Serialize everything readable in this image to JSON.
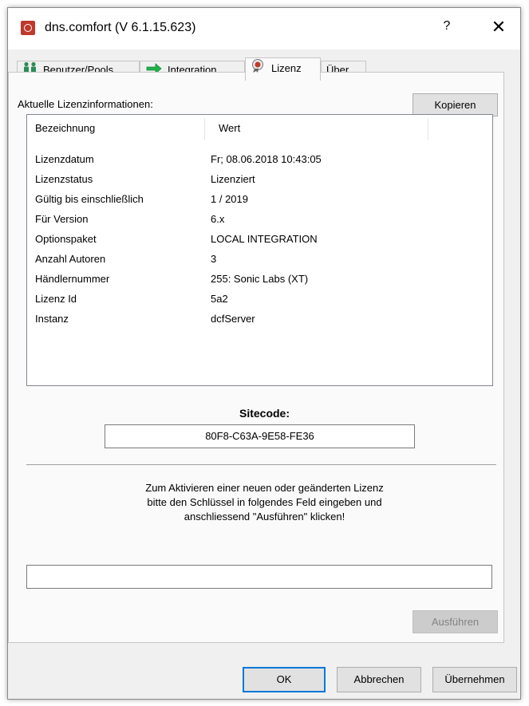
{
  "window": {
    "title": "dns.comfort (V 6.1.15.623)",
    "help": "?",
    "close": "✕"
  },
  "tabs": [
    {
      "label": "Benutzer/Pools",
      "icon": "users-icon"
    },
    {
      "label": "Integration",
      "icon": "green-arrow-icon"
    },
    {
      "label": "Lizenz",
      "icon": "license-seal-icon",
      "active": true
    },
    {
      "label": "Über"
    }
  ],
  "license": {
    "section_label": "Aktuelle Lizenzinformationen:",
    "copy_button": "Kopieren",
    "columns": [
      "Bezeichnung",
      "Wert"
    ],
    "rows": [
      {
        "name": "Lizenzdatum",
        "value": "Fr; 08.06.2018 10:43:05"
      },
      {
        "name": "Lizenzstatus",
        "value": "Lizenziert"
      },
      {
        "name": "Gültig bis einschließlich",
        "value": "1 / 2019"
      },
      {
        "name": "Für Version",
        "value": "6.x"
      },
      {
        "name": "Optionspaket",
        "value": "LOCAL INTEGRATION"
      },
      {
        "name": "Anzahl Autoren",
        "value": "3"
      },
      {
        "name": "Händlernummer",
        "value": "255: Sonic Labs (XT)"
      },
      {
        "name": "Lizenz Id",
        "value": "5a2"
      },
      {
        "name": "Instanz",
        "value": "dcfServer"
      }
    ]
  },
  "sitecode": {
    "label": "Sitecode:",
    "value": "80F8-C63A-9E58-FE36"
  },
  "activation": {
    "hint": "Zum Aktivieren einer neuen oder geänderten Lizenz\nbitte den Schlüssel in folgendes Feld eingeben und\nanschliessend \"Ausführen\" klicken!",
    "key_value": "",
    "execute_button": "Ausführen"
  },
  "footer": {
    "ok": "OK",
    "cancel": "Abbrechen",
    "apply": "Übernehmen"
  },
  "colors": {
    "accent": "#0078d7",
    "app_icon": "#c0392b",
    "users_icon": "#2e8b57",
    "arrow_icon": "#22b14c"
  }
}
